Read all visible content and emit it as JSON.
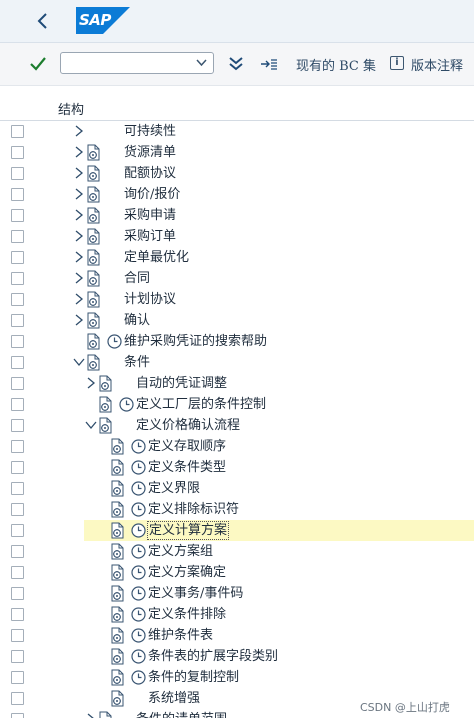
{
  "shell": {
    "logo": "SAP"
  },
  "toolbar": {
    "select_value": "",
    "bc_set": "现有的 BC 集",
    "notes": "版本注释",
    "info_glyph": "i"
  },
  "tree": {
    "header": "结构",
    "rows": [
      {
        "label": "可持续性",
        "level": 0,
        "toggle": "collapsed",
        "icons": []
      },
      {
        "label": "货源清单",
        "level": 0,
        "toggle": "collapsed",
        "icons": [
          "doc"
        ]
      },
      {
        "label": "配额协议",
        "level": 0,
        "toggle": "collapsed",
        "icons": [
          "doc"
        ]
      },
      {
        "label": "询价/报价",
        "level": 0,
        "toggle": "collapsed",
        "icons": [
          "doc"
        ]
      },
      {
        "label": "采购申请",
        "level": 0,
        "toggle": "collapsed",
        "icons": [
          "doc"
        ]
      },
      {
        "label": "采购订单",
        "level": 0,
        "toggle": "collapsed",
        "icons": [
          "doc"
        ]
      },
      {
        "label": "定单最优化",
        "level": 0,
        "toggle": "collapsed",
        "icons": [
          "doc"
        ]
      },
      {
        "label": "合同",
        "level": 0,
        "toggle": "collapsed",
        "icons": [
          "doc"
        ]
      },
      {
        "label": "计划协议",
        "level": 0,
        "toggle": "collapsed",
        "icons": [
          "doc"
        ]
      },
      {
        "label": "确认",
        "level": 0,
        "toggle": "collapsed",
        "icons": [
          "doc"
        ]
      },
      {
        "label": "维护采购凭证的搜索帮助",
        "level": 0,
        "toggle": "none",
        "icons": [
          "doc",
          "clock"
        ]
      },
      {
        "label": "条件",
        "level": 0,
        "toggle": "expanded",
        "icons": [
          "doc"
        ]
      },
      {
        "label": "自动的凭证调整",
        "level": 1,
        "toggle": "collapsed",
        "icons": [
          "doc"
        ]
      },
      {
        "label": "定义工厂层的条件控制",
        "level": 1,
        "toggle": "none",
        "icons": [
          "doc",
          "clock"
        ]
      },
      {
        "label": "定义价格确认流程",
        "level": 1,
        "toggle": "expanded",
        "icons": [
          "doc"
        ]
      },
      {
        "label": "定义存取顺序",
        "level": 2,
        "toggle": "none",
        "icons": [
          "doc",
          "clock"
        ]
      },
      {
        "label": "定义条件类型",
        "level": 2,
        "toggle": "none",
        "icons": [
          "doc",
          "clock"
        ]
      },
      {
        "label": "定义界限",
        "level": 2,
        "toggle": "none",
        "icons": [
          "doc",
          "clock"
        ]
      },
      {
        "label": "定义排除标识符",
        "level": 2,
        "toggle": "none",
        "icons": [
          "doc",
          "clock"
        ]
      },
      {
        "label": "定义计算方案",
        "level": 2,
        "toggle": "none",
        "icons": [
          "doc",
          "clock"
        ],
        "highlight": true
      },
      {
        "label": "定义方案组",
        "level": 2,
        "toggle": "none",
        "icons": [
          "doc",
          "clock"
        ]
      },
      {
        "label": "定义方案确定",
        "level": 2,
        "toggle": "none",
        "icons": [
          "doc",
          "clock"
        ]
      },
      {
        "label": "定义事务/事件码",
        "level": 2,
        "toggle": "none",
        "icons": [
          "doc",
          "clock"
        ]
      },
      {
        "label": "定义条件排除",
        "level": 2,
        "toggle": "none",
        "icons": [
          "doc",
          "clock"
        ]
      },
      {
        "label": "维护条件表",
        "level": 2,
        "toggle": "none",
        "icons": [
          "doc",
          "clock"
        ]
      },
      {
        "label": "条件表的扩展字段类别",
        "level": 2,
        "toggle": "none",
        "icons": [
          "doc",
          "clock"
        ]
      },
      {
        "label": "条件的复制控制",
        "level": 2,
        "toggle": "none",
        "icons": [
          "doc",
          "clock"
        ]
      },
      {
        "label": "系统增强",
        "level": 2,
        "toggle": "none",
        "icons": [
          "doc"
        ]
      },
      {
        "label": "条件的请单范围",
        "level": 1,
        "toggle": "collapsed",
        "icons": [
          "doc"
        ]
      }
    ]
  },
  "watermark": "CSDN @上山打虎",
  "colors": {
    "accent": "#1a70c4",
    "highlight": "#fcf9c3",
    "check": "#1c7d2e",
    "logo": "#0b7bd6"
  }
}
